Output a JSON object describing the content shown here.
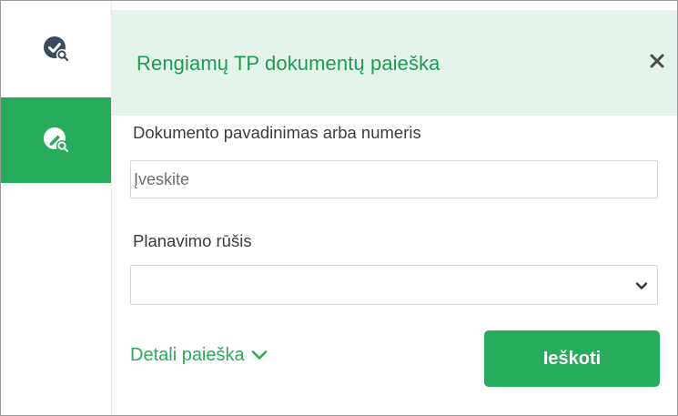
{
  "sidebar": {
    "items": [
      {
        "icon": "approved-documents-search-icon",
        "active": false
      },
      {
        "icon": "draft-documents-search-icon",
        "active": true
      }
    ]
  },
  "panel": {
    "title": "Rengiamų TP dokumentų paieška",
    "close_icon": "close-icon"
  },
  "form": {
    "document_name_label": "Dokumento pavadinimas arba numeris",
    "document_name_value": "",
    "document_name_placeholder": "Įveskite",
    "planning_type_label": "Planavimo rūšis",
    "planning_type_value": "",
    "detailed_search_label": "Detali paieška",
    "search_button_label": "Ieškoti"
  },
  "colors": {
    "accent": "#27ab5c",
    "title": "#1f9a52",
    "header_bg": "#e4f4ea",
    "icon_dark": "#3b4a5c"
  }
}
